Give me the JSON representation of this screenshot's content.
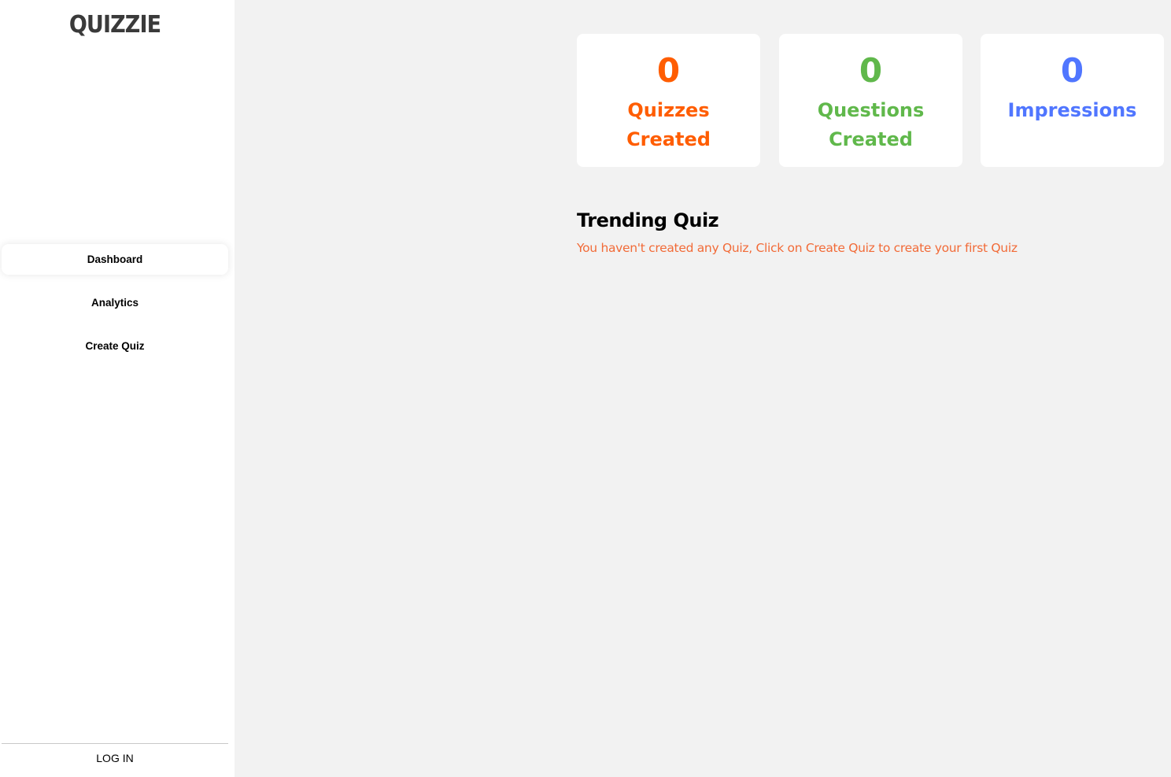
{
  "sidebar": {
    "logo": "QUIZZIE",
    "items": [
      {
        "label": "Dashboard",
        "active": true
      },
      {
        "label": "Analytics",
        "active": false
      },
      {
        "label": "Create Quiz",
        "active": false
      }
    ],
    "login_label": "LOG IN"
  },
  "stats": [
    {
      "count": "0",
      "label": "Quizzes Created",
      "color": "#ff5d01"
    },
    {
      "count": "0",
      "label": "Questions Created",
      "color": "#60b84b"
    },
    {
      "count": "0",
      "label": "Impressions",
      "color": "#5076ff"
    }
  ],
  "trending": {
    "title": "Trending Quiz",
    "empty_message": "You haven't created any Quiz, Click on Create Quiz to create your first Quiz"
  }
}
